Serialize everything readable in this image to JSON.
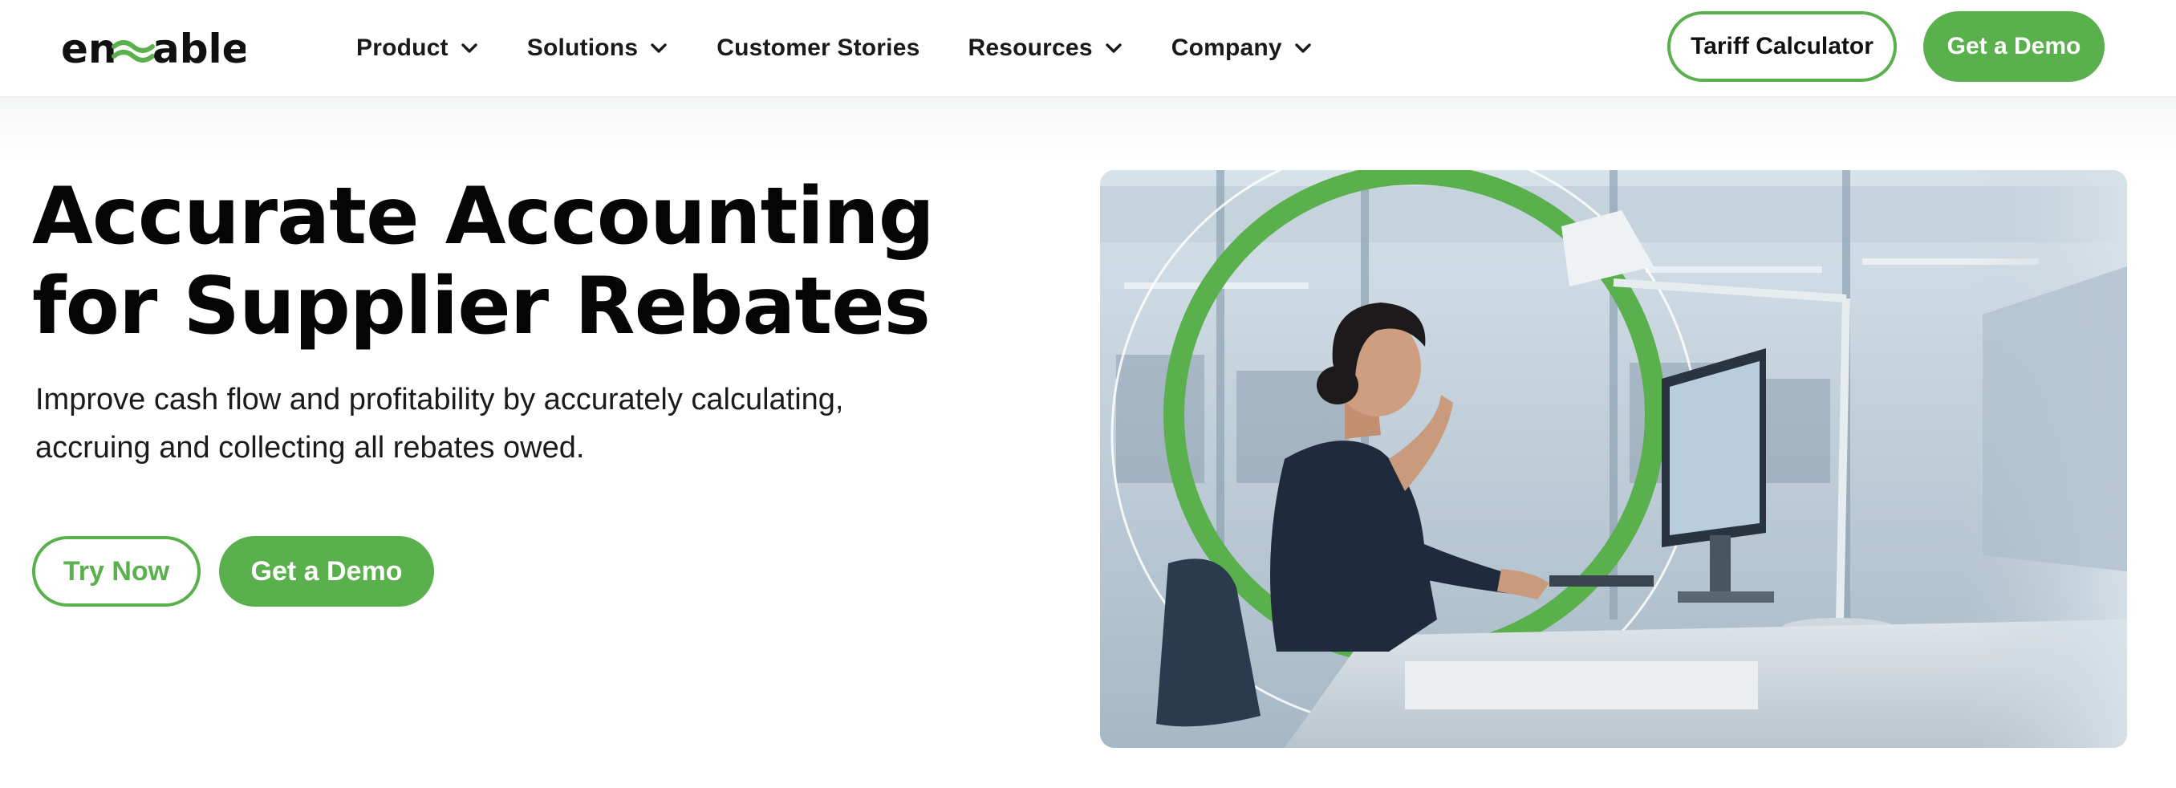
{
  "header": {
    "logo_text": "enable",
    "nav": [
      {
        "label": "Product",
        "has_dropdown": true,
        "icon": "chevron-down-icon"
      },
      {
        "label": "Solutions",
        "has_dropdown": true,
        "icon": "chevron-down-icon"
      },
      {
        "label": "Customer Stories",
        "has_dropdown": false
      },
      {
        "label": "Resources",
        "has_dropdown": true,
        "icon": "chevron-down-icon"
      },
      {
        "label": "Company",
        "has_dropdown": true,
        "icon": "chevron-down-icon"
      }
    ],
    "tariff_button": "Tariff Calculator",
    "demo_button": "Get a Demo"
  },
  "hero": {
    "title_line1": "Accurate Accounting",
    "title_line2": "for Supplier Rebates",
    "subtitle_line1": "Improve cash flow and profitability by accurately calculating,",
    "subtitle_line2": "accruing and collecting all rebates owed.",
    "try_button": "Try Now",
    "demo_button": "Get a Demo",
    "image_subject": "woman-at-computer-in-office"
  },
  "colors": {
    "brand_green": "#5ab04c",
    "text_dark": "#0b0b0b",
    "header_border": "#ececec"
  }
}
